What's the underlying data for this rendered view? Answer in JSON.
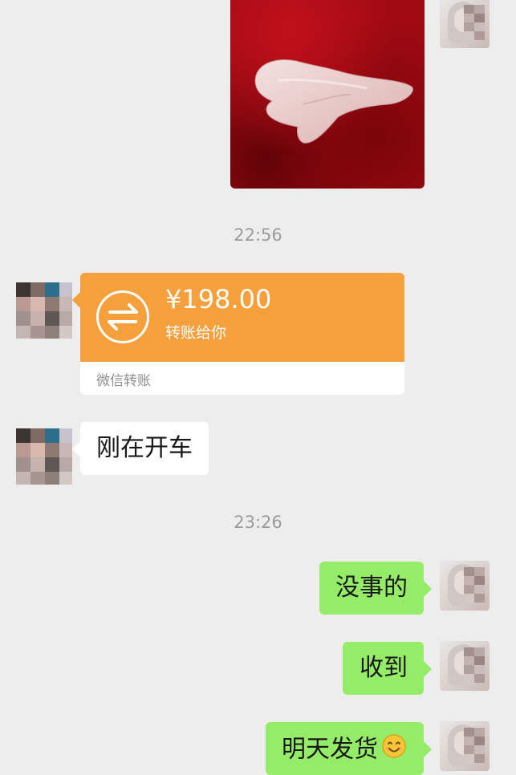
{
  "chat": {
    "time_1": "22:56",
    "time_2": "23:26"
  },
  "transfer": {
    "amount": "¥198.00",
    "label": "转账给你",
    "source": "微信转账",
    "icon": "transfer-arrows-icon",
    "color": "#f6a03d"
  },
  "messages": {
    "incoming_text": "刚在开车",
    "outgoing_1": "没事的",
    "outgoing_2": "收到",
    "outgoing_3": "明天发货",
    "outgoing_3_emoji": "smile-emoji"
  },
  "colors": {
    "background": "#ededed",
    "outgoing_bubble": "#95ec69",
    "incoming_bubble": "#ffffff"
  }
}
